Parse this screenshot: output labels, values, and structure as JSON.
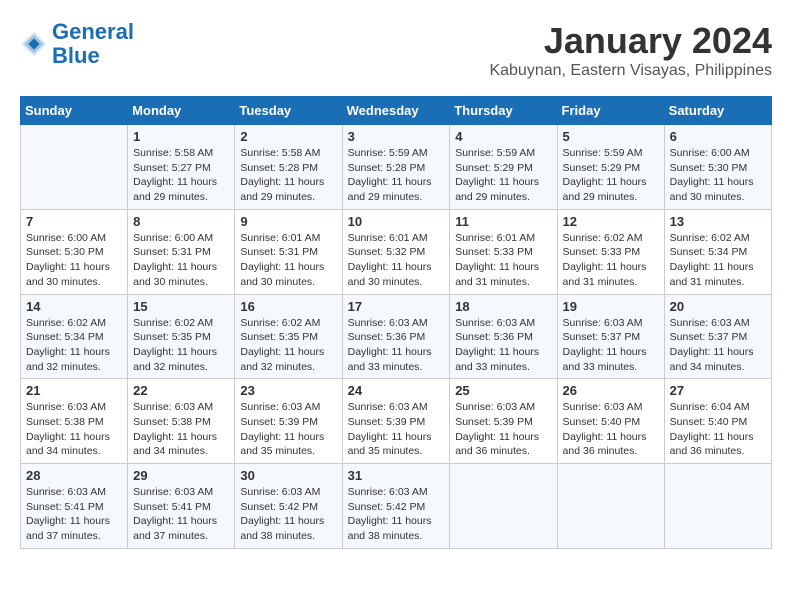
{
  "logo": {
    "line1": "General",
    "line2": "Blue"
  },
  "title": "January 2024",
  "subtitle": "Kabuynan, Eastern Visayas, Philippines",
  "headers": [
    "Sunday",
    "Monday",
    "Tuesday",
    "Wednesday",
    "Thursday",
    "Friday",
    "Saturday"
  ],
  "weeks": [
    [
      {
        "day": "",
        "sunrise": "",
        "sunset": "",
        "daylight": ""
      },
      {
        "day": "1",
        "sunrise": "Sunrise: 5:58 AM",
        "sunset": "Sunset: 5:27 PM",
        "daylight": "Daylight: 11 hours and 29 minutes."
      },
      {
        "day": "2",
        "sunrise": "Sunrise: 5:58 AM",
        "sunset": "Sunset: 5:28 PM",
        "daylight": "Daylight: 11 hours and 29 minutes."
      },
      {
        "day": "3",
        "sunrise": "Sunrise: 5:59 AM",
        "sunset": "Sunset: 5:28 PM",
        "daylight": "Daylight: 11 hours and 29 minutes."
      },
      {
        "day": "4",
        "sunrise": "Sunrise: 5:59 AM",
        "sunset": "Sunset: 5:29 PM",
        "daylight": "Daylight: 11 hours and 29 minutes."
      },
      {
        "day": "5",
        "sunrise": "Sunrise: 5:59 AM",
        "sunset": "Sunset: 5:29 PM",
        "daylight": "Daylight: 11 hours and 29 minutes."
      },
      {
        "day": "6",
        "sunrise": "Sunrise: 6:00 AM",
        "sunset": "Sunset: 5:30 PM",
        "daylight": "Daylight: 11 hours and 30 minutes."
      }
    ],
    [
      {
        "day": "7",
        "sunrise": "Sunrise: 6:00 AM",
        "sunset": "Sunset: 5:30 PM",
        "daylight": "Daylight: 11 hours and 30 minutes."
      },
      {
        "day": "8",
        "sunrise": "Sunrise: 6:00 AM",
        "sunset": "Sunset: 5:31 PM",
        "daylight": "Daylight: 11 hours and 30 minutes."
      },
      {
        "day": "9",
        "sunrise": "Sunrise: 6:01 AM",
        "sunset": "Sunset: 5:31 PM",
        "daylight": "Daylight: 11 hours and 30 minutes."
      },
      {
        "day": "10",
        "sunrise": "Sunrise: 6:01 AM",
        "sunset": "Sunset: 5:32 PM",
        "daylight": "Daylight: 11 hours and 30 minutes."
      },
      {
        "day": "11",
        "sunrise": "Sunrise: 6:01 AM",
        "sunset": "Sunset: 5:33 PM",
        "daylight": "Daylight: 11 hours and 31 minutes."
      },
      {
        "day": "12",
        "sunrise": "Sunrise: 6:02 AM",
        "sunset": "Sunset: 5:33 PM",
        "daylight": "Daylight: 11 hours and 31 minutes."
      },
      {
        "day": "13",
        "sunrise": "Sunrise: 6:02 AM",
        "sunset": "Sunset: 5:34 PM",
        "daylight": "Daylight: 11 hours and 31 minutes."
      }
    ],
    [
      {
        "day": "14",
        "sunrise": "Sunrise: 6:02 AM",
        "sunset": "Sunset: 5:34 PM",
        "daylight": "Daylight: 11 hours and 32 minutes."
      },
      {
        "day": "15",
        "sunrise": "Sunrise: 6:02 AM",
        "sunset": "Sunset: 5:35 PM",
        "daylight": "Daylight: 11 hours and 32 minutes."
      },
      {
        "day": "16",
        "sunrise": "Sunrise: 6:02 AM",
        "sunset": "Sunset: 5:35 PM",
        "daylight": "Daylight: 11 hours and 32 minutes."
      },
      {
        "day": "17",
        "sunrise": "Sunrise: 6:03 AM",
        "sunset": "Sunset: 5:36 PM",
        "daylight": "Daylight: 11 hours and 33 minutes."
      },
      {
        "day": "18",
        "sunrise": "Sunrise: 6:03 AM",
        "sunset": "Sunset: 5:36 PM",
        "daylight": "Daylight: 11 hours and 33 minutes."
      },
      {
        "day": "19",
        "sunrise": "Sunrise: 6:03 AM",
        "sunset": "Sunset: 5:37 PM",
        "daylight": "Daylight: 11 hours and 33 minutes."
      },
      {
        "day": "20",
        "sunrise": "Sunrise: 6:03 AM",
        "sunset": "Sunset: 5:37 PM",
        "daylight": "Daylight: 11 hours and 34 minutes."
      }
    ],
    [
      {
        "day": "21",
        "sunrise": "Sunrise: 6:03 AM",
        "sunset": "Sunset: 5:38 PM",
        "daylight": "Daylight: 11 hours and 34 minutes."
      },
      {
        "day": "22",
        "sunrise": "Sunrise: 6:03 AM",
        "sunset": "Sunset: 5:38 PM",
        "daylight": "Daylight: 11 hours and 34 minutes."
      },
      {
        "day": "23",
        "sunrise": "Sunrise: 6:03 AM",
        "sunset": "Sunset: 5:39 PM",
        "daylight": "Daylight: 11 hours and 35 minutes."
      },
      {
        "day": "24",
        "sunrise": "Sunrise: 6:03 AM",
        "sunset": "Sunset: 5:39 PM",
        "daylight": "Daylight: 11 hours and 35 minutes."
      },
      {
        "day": "25",
        "sunrise": "Sunrise: 6:03 AM",
        "sunset": "Sunset: 5:39 PM",
        "daylight": "Daylight: 11 hours and 36 minutes."
      },
      {
        "day": "26",
        "sunrise": "Sunrise: 6:03 AM",
        "sunset": "Sunset: 5:40 PM",
        "daylight": "Daylight: 11 hours and 36 minutes."
      },
      {
        "day": "27",
        "sunrise": "Sunrise: 6:04 AM",
        "sunset": "Sunset: 5:40 PM",
        "daylight": "Daylight: 11 hours and 36 minutes."
      }
    ],
    [
      {
        "day": "28",
        "sunrise": "Sunrise: 6:03 AM",
        "sunset": "Sunset: 5:41 PM",
        "daylight": "Daylight: 11 hours and 37 minutes."
      },
      {
        "day": "29",
        "sunrise": "Sunrise: 6:03 AM",
        "sunset": "Sunset: 5:41 PM",
        "daylight": "Daylight: 11 hours and 37 minutes."
      },
      {
        "day": "30",
        "sunrise": "Sunrise: 6:03 AM",
        "sunset": "Sunset: 5:42 PM",
        "daylight": "Daylight: 11 hours and 38 minutes."
      },
      {
        "day": "31",
        "sunrise": "Sunrise: 6:03 AM",
        "sunset": "Sunset: 5:42 PM",
        "daylight": "Daylight: 11 hours and 38 minutes."
      },
      {
        "day": "",
        "sunrise": "",
        "sunset": "",
        "daylight": ""
      },
      {
        "day": "",
        "sunrise": "",
        "sunset": "",
        "daylight": ""
      },
      {
        "day": "",
        "sunrise": "",
        "sunset": "",
        "daylight": ""
      }
    ]
  ]
}
